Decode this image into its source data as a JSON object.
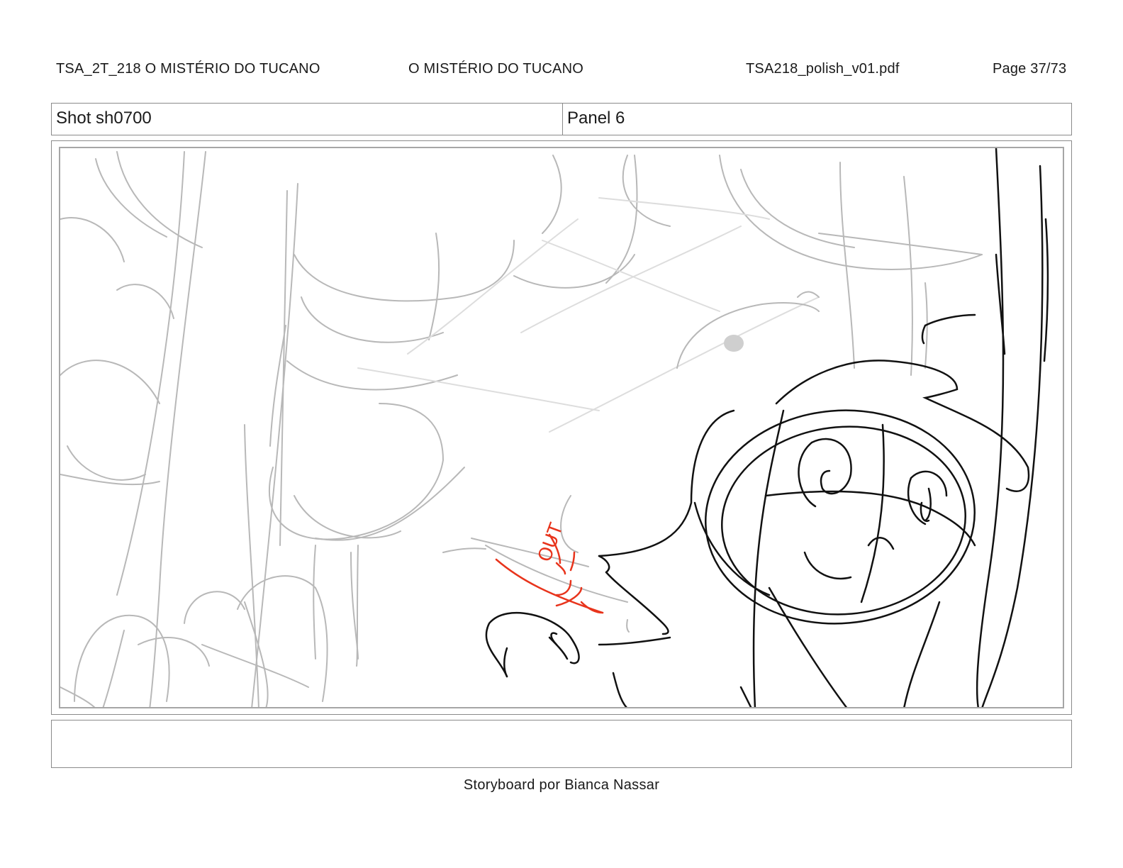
{
  "header": {
    "episode": "TSA_2T_218  O MISTÉRIO DO TUCANO",
    "title": "O MISTÉRIO DO TUCANO",
    "file": "TSA218_polish_v01.pdf",
    "page": "Page 37/73"
  },
  "shot": {
    "label": "Shot sh0700",
    "panel": "Panel 6"
  },
  "drawing": {
    "sfx_text": "OUT",
    "sfx_color": "#e8341c",
    "line_color": "#111111",
    "background_sketch_color": "#b8b8b8"
  },
  "notes": {
    "text": ""
  },
  "footer": {
    "credit": "Storyboard por Bianca Nassar"
  }
}
